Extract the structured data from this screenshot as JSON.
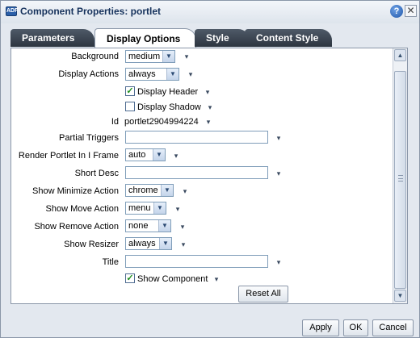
{
  "window": {
    "title": "Component Properties: portlet",
    "help_glyph": "?",
    "close_glyph": "✕",
    "app_icon_text": "ADF"
  },
  "tabs": [
    {
      "label": "Parameters",
      "active": false
    },
    {
      "label": "Display Options",
      "active": true
    },
    {
      "label": "Style",
      "active": false
    },
    {
      "label": "Content Style",
      "active": false
    }
  ],
  "form": {
    "background": {
      "label": "Background",
      "value": "medium"
    },
    "display_actions": {
      "label": "Display Actions",
      "value": "always"
    },
    "display_header": {
      "label": "Display Header",
      "checked": true
    },
    "display_shadow": {
      "label": "Display Shadow",
      "checked": false
    },
    "id": {
      "label": "Id",
      "value": "portlet2904994224"
    },
    "partial_triggers": {
      "label": "Partial Triggers",
      "value": ""
    },
    "render_portlet": {
      "label": "Render Portlet In I Frame",
      "value": "auto"
    },
    "short_desc": {
      "label": "Short Desc",
      "value": ""
    },
    "show_minimize": {
      "label": "Show Minimize Action",
      "value": "chrome"
    },
    "show_move": {
      "label": "Show Move Action",
      "value": "menu"
    },
    "show_remove": {
      "label": "Show Remove Action",
      "value": "none"
    },
    "show_resizer": {
      "label": "Show Resizer",
      "value": "always"
    },
    "title": {
      "label": "Title",
      "value": ""
    },
    "show_component": {
      "label": "Show Component",
      "checked": true
    },
    "reset_label": "Reset All"
  },
  "footer": {
    "apply": "Apply",
    "ok": "OK",
    "cancel": "Cancel"
  },
  "glyphs": {
    "select_arrow": "▼",
    "menu_arrow": "▾",
    "check": "✓",
    "scroll_up": "▲",
    "scroll_down": "▼"
  }
}
